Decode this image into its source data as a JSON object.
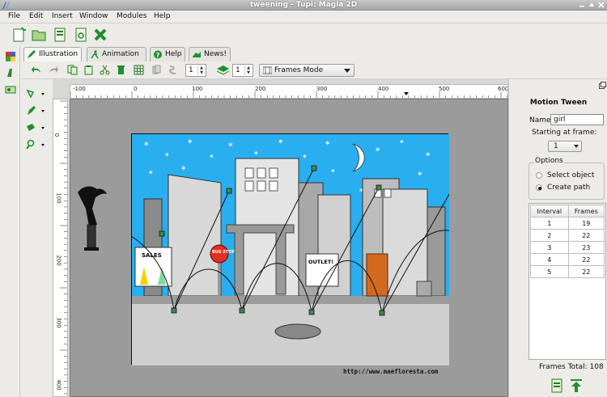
{
  "window": {
    "title": "tweening - Tupi: Magia 2D"
  },
  "menu": [
    {
      "label": "File"
    },
    {
      "label": "Edit"
    },
    {
      "label": "Insert"
    },
    {
      "label": "Window"
    },
    {
      "label": "Modules"
    },
    {
      "label": "Help"
    }
  ],
  "tabs": [
    {
      "label": "Illustration",
      "icon": "pencil-icon"
    },
    {
      "label": "Animation",
      "icon": "running-figure-icon"
    },
    {
      "label": "Help",
      "icon": "help-icon"
    },
    {
      "label": "News!",
      "icon": "news-icon"
    }
  ],
  "toolbar2": {
    "spin1_value": "1",
    "spin2_value": "1",
    "mode_combo": "Frames Mode"
  },
  "ruler": {
    "h_ticks": [
      "-100",
      "0",
      "100",
      "200",
      "300",
      "400",
      "500",
      "600"
    ],
    "v_ticks": [
      "0",
      "100",
      "200",
      "300",
      "400"
    ]
  },
  "canvas": {
    "url_text": "http://www.maefloresta.com",
    "sign_sales": "SALES",
    "sign_outlet": "OUTLET!",
    "sign_bus": "BUS STOP"
  },
  "panel": {
    "title": "Motion Tween",
    "name_label": "Name:",
    "name_value": "girl",
    "start_label": "Starting at frame:",
    "start_value": "1",
    "options_label": "Options",
    "option_select": "Select object",
    "option_path": "Create path",
    "selected_option": "Create path",
    "table_headers": [
      "Interval",
      "Frames"
    ],
    "rows": [
      {
        "interval": "1",
        "frames": "19"
      },
      {
        "interval": "2",
        "frames": "22"
      },
      {
        "interval": "3",
        "frames": "23"
      },
      {
        "interval": "4",
        "frames": "22"
      },
      {
        "interval": "5",
        "frames": "22"
      }
    ],
    "frames_total": "Frames Total: 108"
  },
  "colors": {
    "sky": "#29aef0",
    "accent_green": "#1f8f2f",
    "ruler_bg": "#ffffff",
    "canvas_bg": "#9b9b9b"
  }
}
